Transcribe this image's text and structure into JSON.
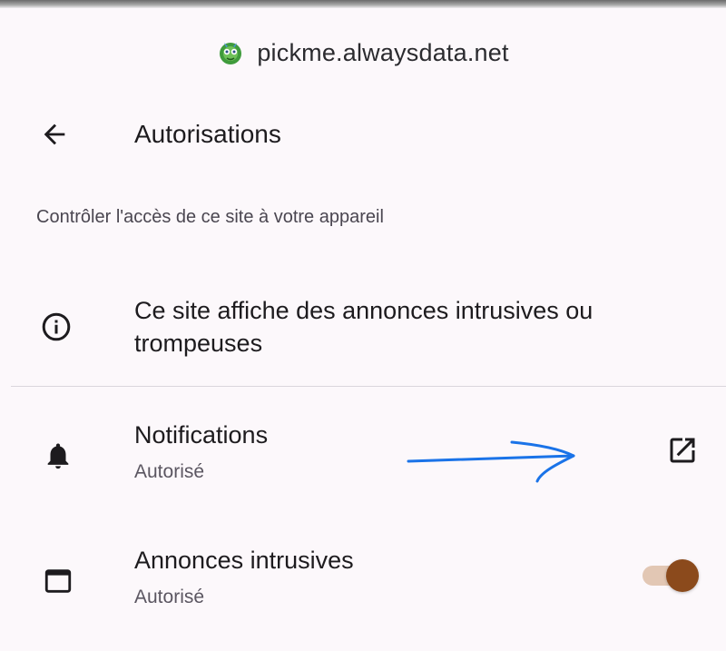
{
  "header": {
    "domain": "pickme.alwaysdata.net",
    "favicon_icon": "site-favicon-icon"
  },
  "titlebar": {
    "back_icon": "arrow-back-icon",
    "title": "Autorisations"
  },
  "section": {
    "description": "Contrôler l'accès de ce site à votre appareil"
  },
  "warning": {
    "icon": "info-icon",
    "text": "Ce site affiche des annonces intrusives ou trompeuses"
  },
  "permissions": [
    {
      "icon": "bell-icon",
      "title": "Notifications",
      "status": "Autorisé",
      "action_icon": "open-in-new-icon"
    },
    {
      "icon": "window-icon",
      "title": "Annonces intrusives",
      "status": "Autorisé",
      "toggle_on": true
    }
  ],
  "colors": {
    "background": "#fcf8fb",
    "toggle_thumb": "#8b4a1c",
    "toggle_track": "#e2c7b4",
    "annotation_arrow": "#1a73e8"
  }
}
